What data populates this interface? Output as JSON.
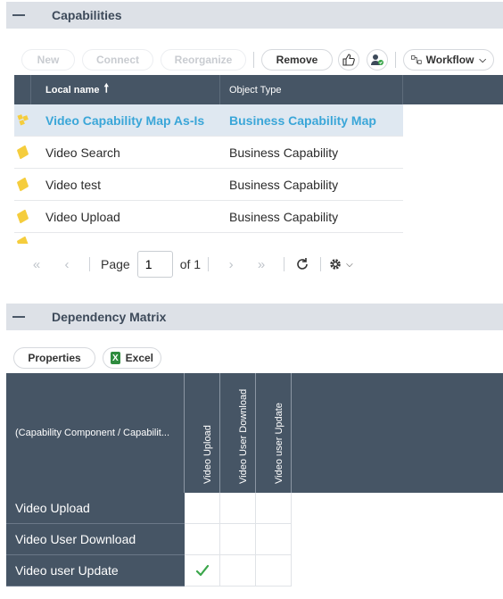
{
  "capabilities": {
    "title": "Capabilities",
    "toolbar": {
      "new": "New",
      "connect": "Connect",
      "reorganize": "Reorganize",
      "remove": "Remove",
      "workflow": "Workflow"
    },
    "columns": {
      "local_name": "Local name",
      "object_type": "Object Type"
    },
    "rows": [
      {
        "name": "Video Capability Map As-Is",
        "type": "Business Capability Map",
        "icon": "capability-map-icon",
        "selected": true
      },
      {
        "name": "Video Search",
        "type": "Business Capability",
        "icon": "capability-icon"
      },
      {
        "name": "Video test",
        "type": "Business Capability",
        "icon": "capability-icon"
      },
      {
        "name": "Video Upload",
        "type": "Business Capability",
        "icon": "capability-icon"
      }
    ],
    "pager": {
      "page_label": "Page",
      "page_value": "1",
      "of_label": "of 1"
    }
  },
  "dependency": {
    "title": "Dependency Matrix",
    "properties": "Properties",
    "excel": "Excel",
    "corner_label": "(Capability Component / Capabilit...",
    "columns": [
      "Video Upload",
      "Video User Download",
      "Video user Update"
    ],
    "rows": [
      {
        "label": "Video Upload",
        "marks": [
          false,
          false,
          false
        ]
      },
      {
        "label": "Video User Download",
        "marks": [
          false,
          false,
          false
        ]
      },
      {
        "label": "Video user Update",
        "marks": [
          true,
          false,
          false
        ]
      }
    ]
  },
  "colors": {
    "header_bg": "#465565",
    "accent": "#3aa6d8",
    "section_bg": "#dde1e7",
    "check": "#3aa64a"
  }
}
